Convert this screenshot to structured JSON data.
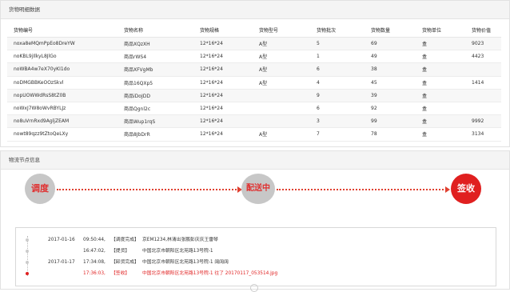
{
  "goods_panel": {
    "title": "货物明细数据",
    "columns": [
      "货物编号",
      "货物名称",
      "货物规格",
      "货物型号",
      "货物批次",
      "货物数量",
      "货物单位",
      "货物价值"
    ],
    "rows": [
      [
        "noxa8eMQmPpEo8DreYW",
        "商品XQzXH",
        "12*16*24",
        "A型",
        "5",
        "69",
        "盒",
        "9023"
      ],
      [
        "noKBL9jIlkyL8JlGo",
        "商品rWS4",
        "12*16*24",
        "A型",
        "1",
        "49",
        "盒",
        "4423"
      ],
      [
        "noWBA4w7eX70yKI1do",
        "商品XFVgMb",
        "12*16*24",
        "A型",
        "6",
        "38",
        "盒",
        ""
      ],
      [
        "noDMGBBKeOOzSkvl",
        "商品16QXp5",
        "12*16*24",
        "A型",
        "4",
        "45",
        "盒",
        "1414"
      ],
      [
        "nopUOWWdRsS8tZ0B",
        "商品iDoJDD",
        "12*16*24",
        "",
        "9",
        "39",
        "盒",
        ""
      ],
      [
        "noWxJ7W8oWvRBYLJz",
        "商品Qgnl2c",
        "12*16*24",
        "",
        "6",
        "92",
        "盒",
        ""
      ],
      [
        "no8uVrnRxd9AgljZEAM",
        "商品Wup1rqS",
        "12*16*24",
        "",
        "3",
        "99",
        "盒",
        "9992"
      ],
      [
        "nowt89qzz9tZtoQeLXy",
        "商品8JbDrR",
        "12*16*24",
        "A型",
        "7",
        "78",
        "盒",
        "3134"
      ]
    ]
  },
  "node_panel": {
    "title": "物流节点信息",
    "nodes": [
      "调度",
      "配送中",
      "签收"
    ]
  },
  "log": {
    "entries": [
      {
        "date": "2017-01-16",
        "time": "09:50:44,",
        "tag": "【调度完成】",
        "text": "京EM1234,林清出张鹏彭庆庆王雷琴",
        "current": false
      },
      {
        "date": "",
        "time": "16:47:02,",
        "tag": "【提货】",
        "text": "中国北京市朝阳区北苑路13号院-1",
        "current": false
      },
      {
        "date": "2017-01-17",
        "time": "17:34:08,",
        "tag": "【卸货完成】",
        "text": "中国北京市朝阳区北苑路13号院-1  阔阔阔",
        "current": false
      },
      {
        "date": "",
        "time": "17:36:03,",
        "tag": "【签收】",
        "text": "中国北京市朝阳区北苑路13号院-1  往了 20170117_053514.jpg",
        "current": true
      }
    ]
  }
}
